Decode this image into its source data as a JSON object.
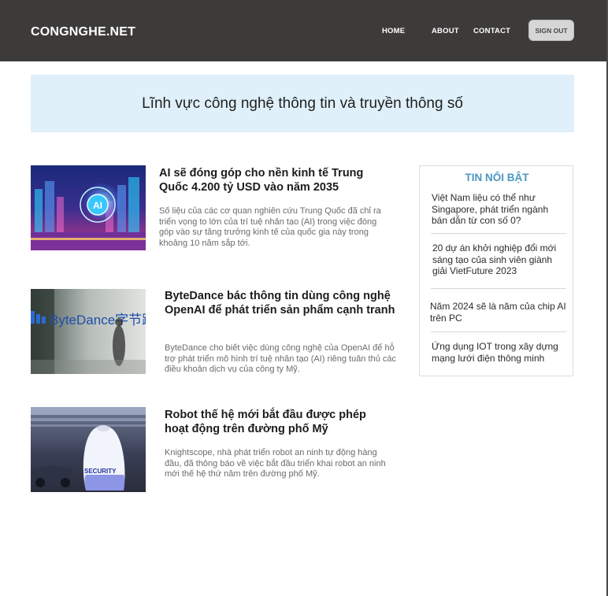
{
  "header": {
    "brand": "CONGNGHE.NET",
    "nav": [
      {
        "label": "HOME"
      },
      {
        "label": "ABOUT"
      },
      {
        "label": "CONTACT"
      }
    ],
    "signout_label": "SIGN OUT"
  },
  "banner": {
    "title": "Lĩnh vực công nghệ thông tin và truyền thông số"
  },
  "articles": [
    {
      "title": "AI sẽ đóng góp cho nền kinh tế Trung Quốc 4.200 tỷ USD vào năm 2035",
      "excerpt": "Số liệu của các cơ quan nghiên cứu Trung Quốc đã chỉ ra triển vọng to lớn của trí tuệ nhân tạo (AI) trong việc đóng góp vào sự tăng trưởng kinh tế của quốc gia này trong khoảng 10 năm sắp tới.",
      "image": "ai-city-image"
    },
    {
      "title": "ByteDance bác thông tin dùng công nghệ OpenAI để phát triển sản phẩm cạnh tranh",
      "excerpt": "ByteDance cho biết việc dùng công nghệ của OpenAI để hỗ trợ phát triển mô hình trí tuệ nhân tạo (AI) riêng tuân thủ các điều khoản dịch vụ của công ty Mỹ.",
      "image": "bytedance-office-image",
      "image_text": "ByteDance字节跳动"
    },
    {
      "title": "Robot thế hệ mới bắt đầu được phép hoạt động trên đường phố Mỹ",
      "excerpt": "Knightscope, nhà phát triển robot an ninh tự động hàng đầu, đã thông báo về việc bắt đầu triển khai robot an ninh mới thế hệ thứ năm trên đường phố Mỹ.",
      "image": "security-robot-image",
      "image_text": "SECURITY"
    }
  ],
  "sidebar": {
    "title": "TIN NỔI BẬT",
    "items": [
      {
        "label": "Việt Nam liệu có thể như Singapore, phát triển ngành bán dẫn từ con số 0?"
      },
      {
        "label": "20 dự án khởi nghiệp đổi mới sáng tạo của sinh viên giành giải VietFuture 2023"
      },
      {
        "label": "Năm 2024 sẽ là năm của chip AI trên PC"
      },
      {
        "label": "Ứng dụng IOT trong xây dựng mạng lưới điện thông minh"
      }
    ]
  },
  "colors": {
    "header_bg": "#3d3b3a",
    "banner_bg": "#dff0fa",
    "sidebar_title": "#4b97c4"
  }
}
